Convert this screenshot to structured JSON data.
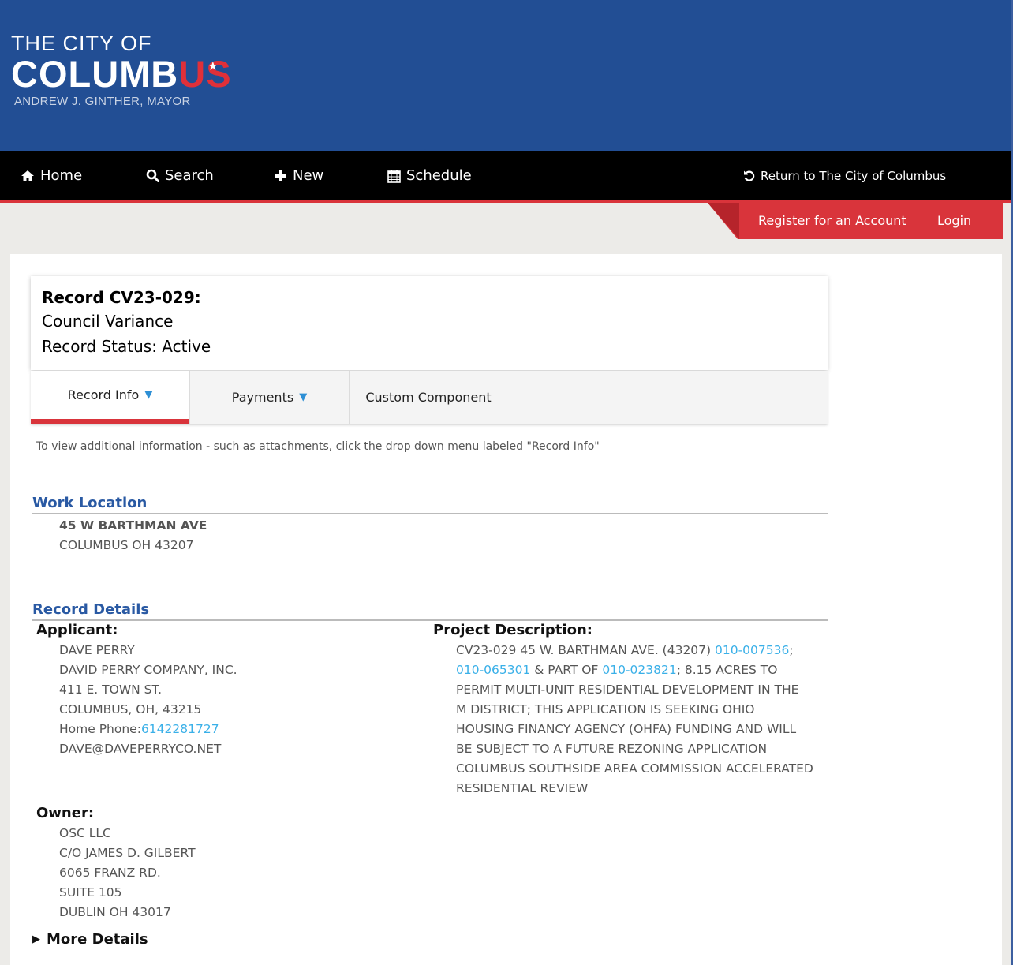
{
  "header": {
    "logo_line1": "THE CITY OF",
    "logo_line2_a": "COLUMB",
    "logo_line2_b": "US",
    "logo_line3": "ANDREW J. GINTHER, MAYOR",
    "brand_blue": "#224e94",
    "accent_red": "#d9343b"
  },
  "nav": {
    "home": "Home",
    "search": "Search",
    "new": "New",
    "schedule": "Schedule",
    "return": "Return to The City of Columbus"
  },
  "account": {
    "register": "Register for an Account",
    "login": "Login"
  },
  "record": {
    "title": "Record CV23-029:",
    "type": "Council Variance",
    "status": "Record Status: Active"
  },
  "tabs": {
    "record_info": "Record Info",
    "payments": "Payments",
    "custom": "Custom Component"
  },
  "hint": "To view additional information - such as attachments, click the drop down menu labeled \"Record Info\"",
  "work_location": {
    "heading": "Work Location",
    "street": "45 W BARTHMAN AVE",
    "city": "COLUMBUS OH 43207"
  },
  "record_details": {
    "heading": "Record Details",
    "applicant_label": "Applicant:",
    "applicant": {
      "name": "DAVE PERRY",
      "company": "DAVID PERRY COMPANY, INC.",
      "street": "411 E. TOWN ST.",
      "city": "COLUMBUS, OH, 43215",
      "phone_label": "Home Phone:",
      "phone": "6142281727",
      "email": "DAVE@DAVEPERRYCO.NET"
    },
    "project_label": "Project Description:",
    "project": {
      "l1a": "CV23-029 45 W. BARTHMAN AVE. (43207) ",
      "parcel1": "010-007536",
      "l1b": ";",
      "parcel2": "010-065301",
      "l2a": " & PART OF ",
      "parcel3": "010-023821",
      "l2b": "; 8.15 ACRES TO",
      "l3": "PERMIT MULTI-UNIT RESIDENTIAL DEVELOPMENT IN THE",
      "l4": "M DISTRICT; THIS APPLICATION IS SEEKING OHIO",
      "l5": "HOUSING FINANCY AGENCY (OHFA) FUNDING AND WILL",
      "l6": "BE SUBJECT TO A FUTURE REZONING APPLICATION",
      "l7": "COLUMBUS SOUTHSIDE AREA COMMISSION ACCELERATED",
      "l8": "RESIDENTIAL REVIEW"
    },
    "owner_label": "Owner:",
    "owner": {
      "name": "OSC LLC",
      "care_of": "C/O JAMES D. GILBERT",
      "street": "6065 FRANZ RD.",
      "suite": "SUITE 105",
      "city": "DUBLIN OH 43017"
    },
    "more_details": "More Details"
  }
}
